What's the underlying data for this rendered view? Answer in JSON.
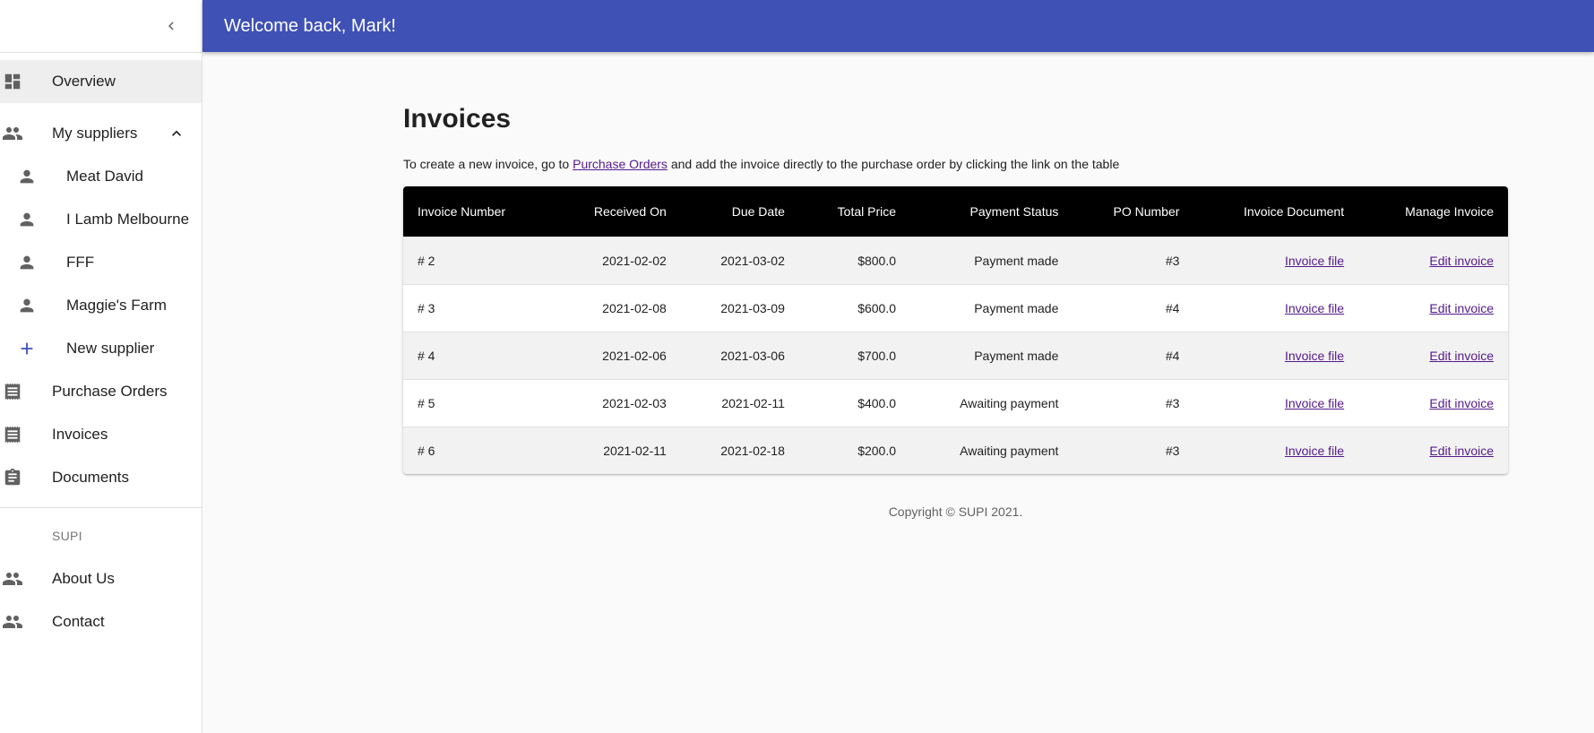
{
  "appbar": {
    "title": "Welcome back, Mark!"
  },
  "sidebar": {
    "collapse_icon": "chevron-left-icon",
    "items": [
      {
        "label": "Overview",
        "icon": "dashboard-icon"
      },
      {
        "label": "My suppliers",
        "icon": "people-icon",
        "expand_icon": "chevron-up-icon"
      },
      {
        "label": "Meat David",
        "icon": "person-icon"
      },
      {
        "label": "I Lamb Melbourne",
        "icon": "person-icon"
      },
      {
        "label": "FFF",
        "icon": "person-icon"
      },
      {
        "label": "Maggie's Farm",
        "icon": "person-icon"
      },
      {
        "label": "New supplier",
        "icon": "add-icon"
      },
      {
        "label": "Purchase Orders",
        "icon": "receipt-icon"
      },
      {
        "label": "Invoices",
        "icon": "receipt-icon"
      },
      {
        "label": "Documents",
        "icon": "assignment-icon"
      }
    ],
    "section_header": "SUPI",
    "section_items": [
      {
        "label": "About Us",
        "icon": "people-icon"
      },
      {
        "label": "Contact",
        "icon": "people-icon"
      }
    ]
  },
  "main": {
    "title": "Invoices",
    "intro_before": "To create a new invoice, go to ",
    "intro_link": "Purchase Orders",
    "intro_after": " and add the invoice directly to the purchase order by clicking the link on the table",
    "table": {
      "headers": [
        "Invoice Number",
        "Received On",
        "Due Date",
        "Total Price",
        "Payment Status",
        "PO Number",
        "Invoice Document",
        "Manage Invoice"
      ],
      "rows": [
        [
          "# 2",
          "2021-02-02",
          "2021-03-02",
          "$800.0",
          "Payment made",
          "#3",
          "Invoice file",
          "Edit invoice"
        ],
        [
          "# 3",
          "2021-02-08",
          "2021-03-09",
          "$600.0",
          "Payment made",
          "#4",
          "Invoice file",
          "Edit invoice"
        ],
        [
          "# 4",
          "2021-02-06",
          "2021-03-06",
          "$700.0",
          "Payment made",
          "#4",
          "Invoice file",
          "Edit invoice"
        ],
        [
          "# 5",
          "2021-02-03",
          "2021-02-11",
          "$400.0",
          "Awaiting payment",
          "#3",
          "Invoice file",
          "Edit invoice"
        ],
        [
          "# 6",
          "2021-02-11",
          "2021-02-18",
          "$200.0",
          "Awaiting payment",
          "#3",
          "Invoice file",
          "Edit invoice"
        ]
      ]
    },
    "footer": "Copyright © SUPI 2021."
  },
  "colors": {
    "appbar": "#3f51b5",
    "table_header": "#000000",
    "link": "#551a8b",
    "add_icon": "#3f51b5"
  }
}
